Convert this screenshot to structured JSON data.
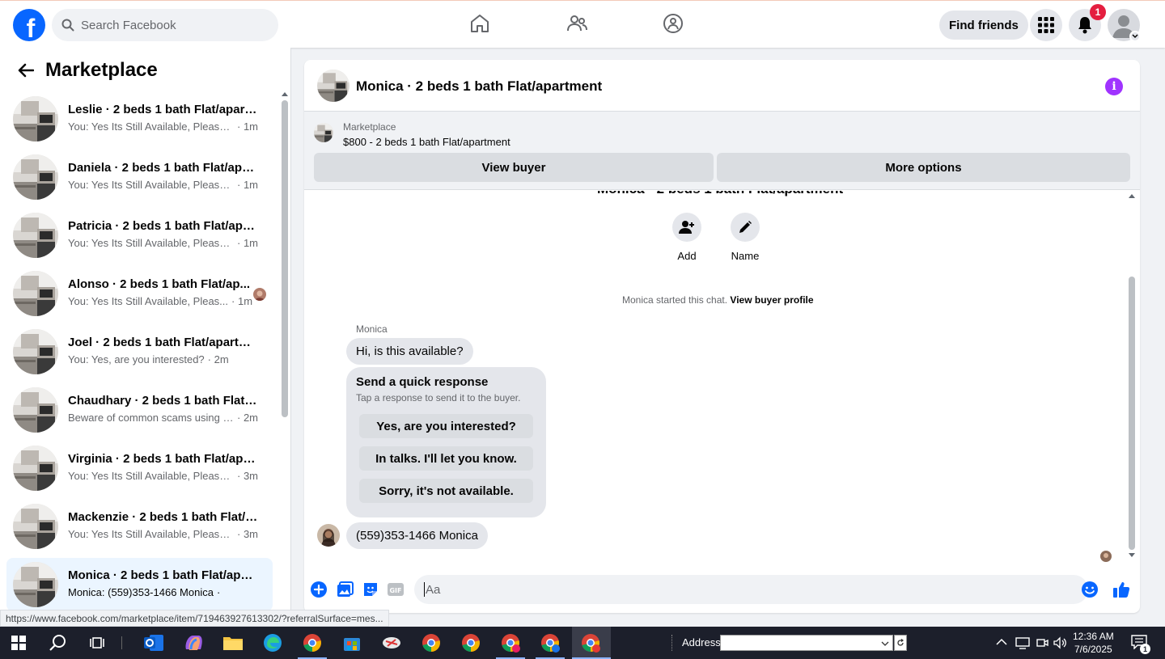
{
  "header": {
    "search_placeholder": "Search Facebook",
    "find_friends": "Find friends",
    "notification_count": "1",
    "brand_color": "#0866ff"
  },
  "sidebar": {
    "title": "Marketplace",
    "conversations": [
      {
        "name": "Leslie · 2 beds 1 bath Flat/apart...",
        "preview": "You: Yes Its Still Available, Please S...",
        "time": "· 1m"
      },
      {
        "name": "Daniela · 2 beds 1 bath Flat/apar...",
        "preview": "You: Yes Its Still Available, Please S...",
        "time": "· 1m"
      },
      {
        "name": "Patricia · 2 beds 1 bath Flat/apar...",
        "preview": "You: Yes Its Still Available, Please S...",
        "time": "· 1m"
      },
      {
        "name": "Alonso · 2 beds 1 bath Flat/ap...",
        "preview": "You: Yes Its Still Available, Pleas...",
        "time": "· 1m"
      },
      {
        "name": "Joel · 2 beds 1 bath Flat/apartm...",
        "preview": "You: Yes, are you interested?",
        "time": "· 2m"
      },
      {
        "name": "Chaudhary · 2 beds 1 bath Flat/a...",
        "preview": "Beware of common scams using p...",
        "time": "· 2m"
      },
      {
        "name": "Virginia · 2 beds 1 bath Flat/apar...",
        "preview": "You: Yes Its Still Available, Please S...",
        "time": "· 3m"
      },
      {
        "name": "Mackenzie · 2 beds 1 bath Flat/a...",
        "preview": "You: Yes Its Still Available, Please S...",
        "time": "· 3m"
      },
      {
        "name": "Monica · 2 beds 1 bath Flat/apar...",
        "preview": "Monica: (559)353-1466 Monica",
        "time": "·"
      }
    ]
  },
  "chat": {
    "title": "Monica · 2 beds 1 bath Flat/apartment",
    "banner_label": "Marketplace",
    "banner_item": "$800 - 2 beds 1 bath Flat/apartment",
    "view_buyer": "View buyer",
    "more_options": "More options",
    "add_label": "Add",
    "name_label": "Name",
    "started_text": "Monica started this chat.",
    "view_buyer_profile": "View buyer profile",
    "sender": "Monica",
    "msg1": "Hi, is this available?",
    "quick_title": "Send a quick response",
    "quick_sub": "Tap a response to send it to the buyer.",
    "quick_options": [
      "Yes, are you interested?",
      "In talks. I'll let you know.",
      "Sorry, it's not available."
    ],
    "msg2": "(559)353-1466 Monica",
    "composer_placeholder": "Aa",
    "accent_color": "#0866ff",
    "info_color": "#a033ff"
  },
  "status_url": "https://www.facebook.com/marketplace/item/719463927613302/?referralSurface=mes...",
  "taskbar": {
    "address_label": "Address",
    "time": "12:36 AM",
    "date": "7/6/2025",
    "notif_count": "1"
  }
}
